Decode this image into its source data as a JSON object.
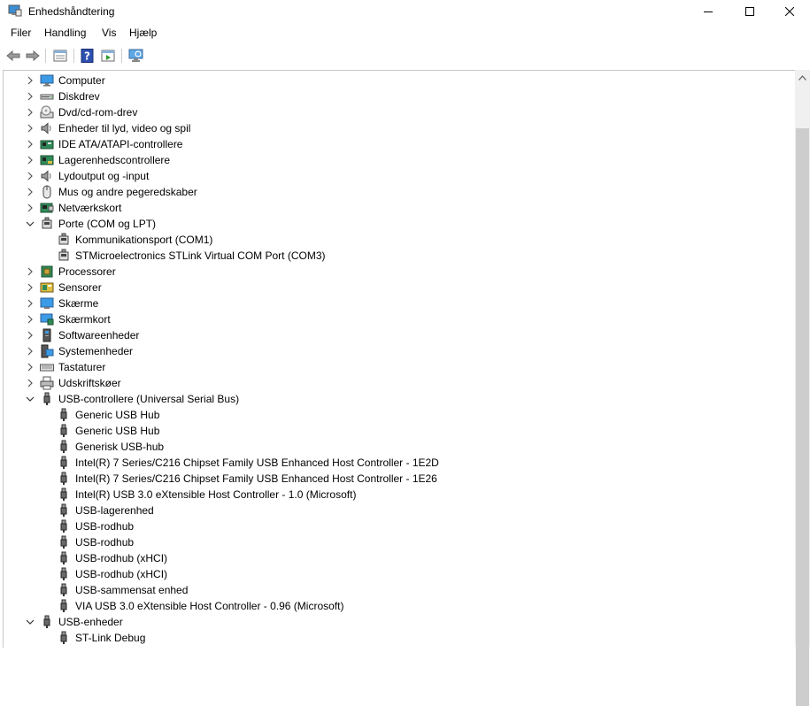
{
  "window": {
    "title": "Enhedshåndtering"
  },
  "menu": [
    "Filer",
    "Handling",
    "Vis",
    "Hjælp"
  ],
  "tree": [
    {
      "label": "Computer",
      "level": 0,
      "expander": "collapsed",
      "icon": "computer-icon"
    },
    {
      "label": "Diskdrev",
      "level": 0,
      "expander": "collapsed",
      "icon": "disk-drive-icon"
    },
    {
      "label": "Dvd/cd-rom-drev",
      "level": 0,
      "expander": "collapsed",
      "icon": "dvd-drive-icon"
    },
    {
      "label": "Enheder til lyd, video og spil",
      "level": 0,
      "expander": "collapsed",
      "icon": "speaker-icon"
    },
    {
      "label": "IDE ATA/ATAPI-controllere",
      "level": 0,
      "expander": "collapsed",
      "icon": "ide-controller-icon"
    },
    {
      "label": "Lagerenhedscontrollere",
      "level": 0,
      "expander": "collapsed",
      "icon": "storage-controller-icon"
    },
    {
      "label": "Lydoutput og -input",
      "level": 0,
      "expander": "collapsed",
      "icon": "speaker-icon"
    },
    {
      "label": "Mus og andre pegeredskaber",
      "level": 0,
      "expander": "collapsed",
      "icon": "mouse-icon"
    },
    {
      "label": "Netværkskort",
      "level": 0,
      "expander": "collapsed",
      "icon": "network-card-icon"
    },
    {
      "label": "Porte (COM og LPT)",
      "level": 0,
      "expander": "expanded",
      "icon": "port-icon"
    },
    {
      "label": "Kommunikationsport (COM1)",
      "level": 1,
      "expander": "none",
      "icon": "port-icon"
    },
    {
      "label": "STMicroelectronics STLink Virtual COM Port (COM3)",
      "level": 1,
      "expander": "none",
      "icon": "port-icon"
    },
    {
      "label": "Processorer",
      "level": 0,
      "expander": "collapsed",
      "icon": "processor-icon"
    },
    {
      "label": "Sensorer",
      "level": 0,
      "expander": "collapsed",
      "icon": "sensor-icon"
    },
    {
      "label": "Skærme",
      "level": 0,
      "expander": "collapsed",
      "icon": "monitor-icon"
    },
    {
      "label": "Skærmkort",
      "level": 0,
      "expander": "collapsed",
      "icon": "display-adapter-icon"
    },
    {
      "label": "Softwareenheder",
      "level": 0,
      "expander": "collapsed",
      "icon": "software-device-icon"
    },
    {
      "label": "Systemenheder",
      "level": 0,
      "expander": "collapsed",
      "icon": "system-device-icon"
    },
    {
      "label": "Tastaturer",
      "level": 0,
      "expander": "collapsed",
      "icon": "keyboard-icon"
    },
    {
      "label": "Udskriftskøer",
      "level": 0,
      "expander": "collapsed",
      "icon": "printer-icon"
    },
    {
      "label": "USB-controllere (Universal Serial Bus)",
      "level": 0,
      "expander": "expanded",
      "icon": "usb-icon"
    },
    {
      "label": "Generic USB Hub",
      "level": 1,
      "expander": "none",
      "icon": "usb-icon"
    },
    {
      "label": "Generic USB Hub",
      "level": 1,
      "expander": "none",
      "icon": "usb-icon"
    },
    {
      "label": "Generisk USB-hub",
      "level": 1,
      "expander": "none",
      "icon": "usb-icon"
    },
    {
      "label": "Intel(R) 7 Series/C216 Chipset Family USB Enhanced Host Controller - 1E2D",
      "level": 1,
      "expander": "none",
      "icon": "usb-icon"
    },
    {
      "label": "Intel(R) 7 Series/C216 Chipset Family USB Enhanced Host Controller - 1E26",
      "level": 1,
      "expander": "none",
      "icon": "usb-icon"
    },
    {
      "label": "Intel(R) USB 3.0 eXtensible Host Controller - 1.0 (Microsoft)",
      "level": 1,
      "expander": "none",
      "icon": "usb-icon"
    },
    {
      "label": "USB-lagerenhed",
      "level": 1,
      "expander": "none",
      "icon": "usb-icon"
    },
    {
      "label": "USB-rodhub",
      "level": 1,
      "expander": "none",
      "icon": "usb-icon"
    },
    {
      "label": "USB-rodhub",
      "level": 1,
      "expander": "none",
      "icon": "usb-icon"
    },
    {
      "label": "USB-rodhub (xHCI)",
      "level": 1,
      "expander": "none",
      "icon": "usb-icon"
    },
    {
      "label": "USB-rodhub (xHCI)",
      "level": 1,
      "expander": "none",
      "icon": "usb-icon"
    },
    {
      "label": "USB-sammensat enhed",
      "level": 1,
      "expander": "none",
      "icon": "usb-icon"
    },
    {
      "label": "VIA USB 3.0 eXtensible Host Controller - 0.96 (Microsoft)",
      "level": 1,
      "expander": "none",
      "icon": "usb-icon"
    },
    {
      "label": "USB-enheder",
      "level": 0,
      "expander": "expanded",
      "icon": "usb-icon"
    },
    {
      "label": "ST-Link Debug",
      "level": 1,
      "expander": "none",
      "icon": "usb-icon"
    }
  ]
}
